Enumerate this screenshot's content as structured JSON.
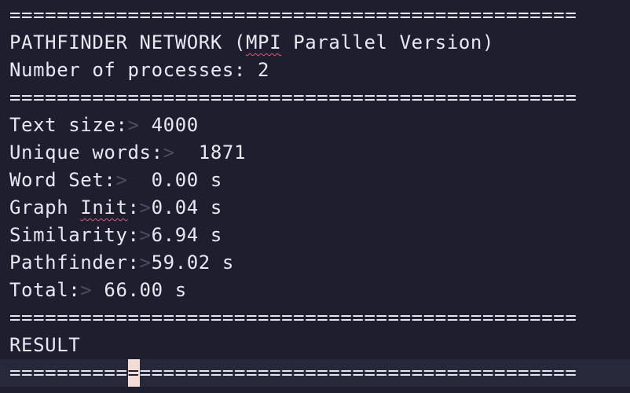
{
  "terminal": {
    "separator": "================================================",
    "title_prefix": "PATHFINDER NETWORK (",
    "title_misspelled": "MPI",
    "title_suffix": " Parallel Version)",
    "processes_line": "Number of processes: 2",
    "metrics": {
      "text_size": {
        "label": "Text size:",
        "marker": ">",
        "value": " 4000"
      },
      "unique_words": {
        "label": "Unique words:",
        "marker": ">",
        "value": "  1871"
      },
      "word_set": {
        "label": "Word Set:",
        "marker": ">",
        "value": "  0.00 s"
      },
      "graph_init": {
        "label_prefix": "Graph ",
        "label_misspelled": "Init",
        "label_suffix": ":",
        "marker": ">",
        "value": "0.04 s"
      },
      "similarity": {
        "label": "Similarity:",
        "marker": ">",
        "value": "6.94 s"
      },
      "pathfinder": {
        "label": "Pathfinder:",
        "marker": ">",
        "value": "59.02 s"
      },
      "total": {
        "label": "Total:",
        "marker": ">",
        "value": " 66.00 s"
      }
    },
    "result_label": "RESULT",
    "cursor_line": {
      "before": "==========",
      "cursor_char": "=",
      "after": "=====================================",
      "cursor_color": "#f3dcd6"
    }
  }
}
